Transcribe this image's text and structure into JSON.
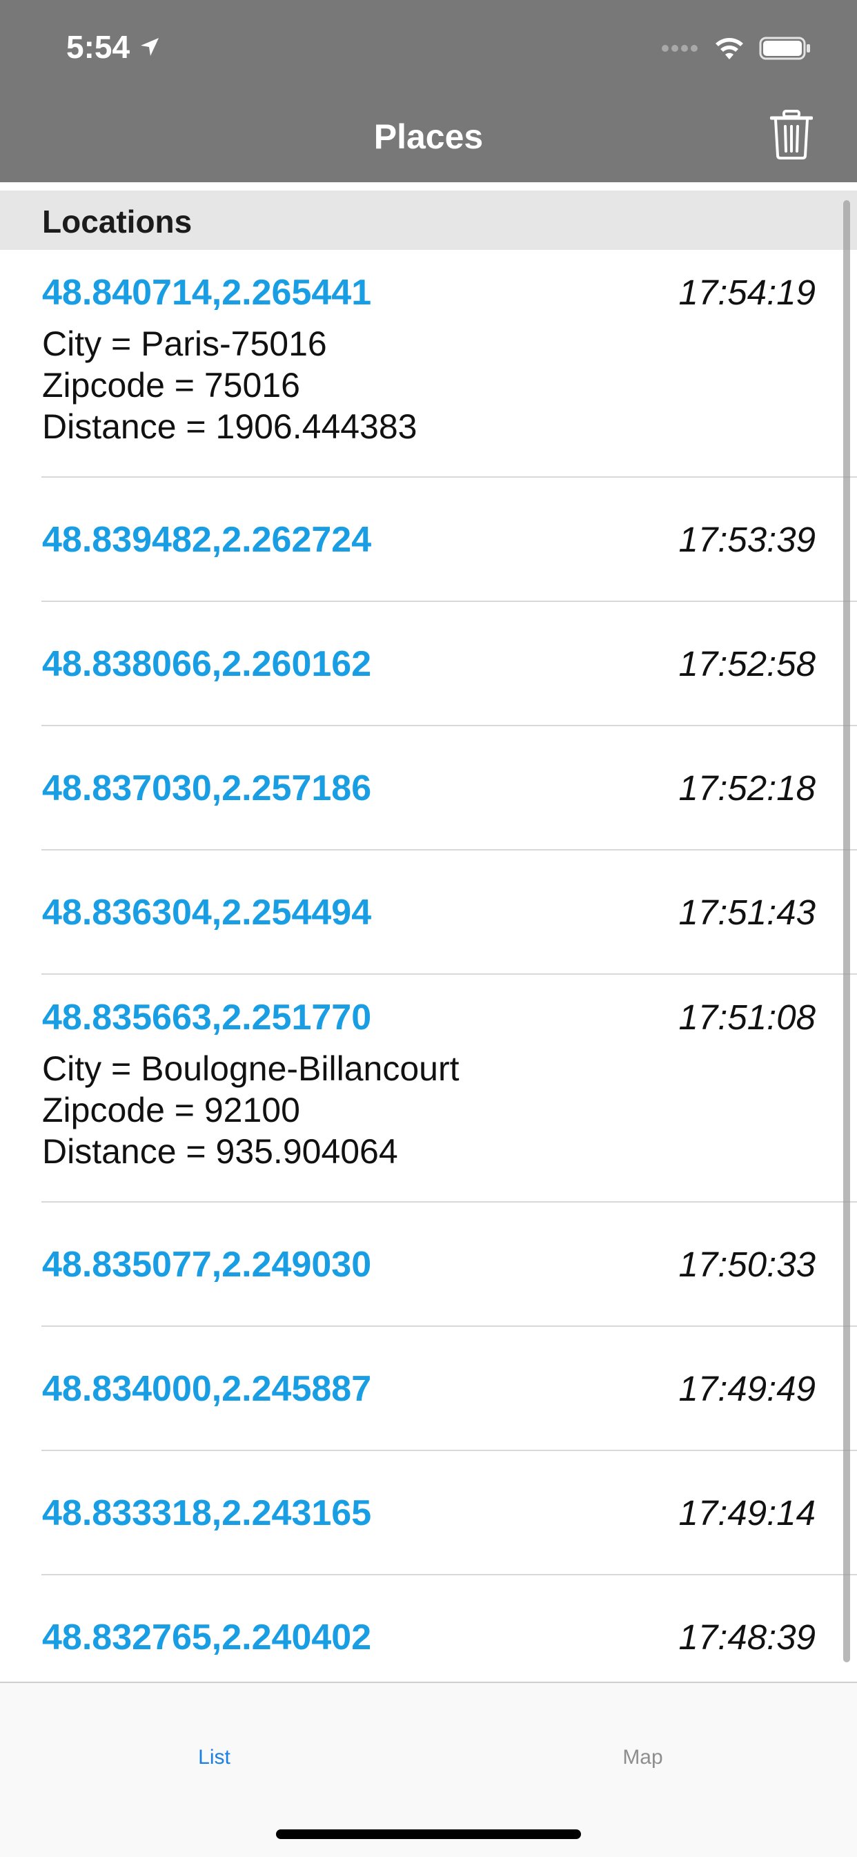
{
  "status_bar": {
    "time": "5:54",
    "icons": [
      "location-arrow-icon",
      "signal-dots-icon",
      "wifi-icon",
      "battery-icon"
    ]
  },
  "nav": {
    "title": "Places",
    "action_icon": "trash-icon"
  },
  "section": {
    "title": "Locations"
  },
  "locations": [
    {
      "coords": "48.840714,2.265441",
      "time": "17:54:19",
      "city": "City = Paris-75016",
      "zipcode": "Zipcode = 75016",
      "distance": "Distance = 1906.444383"
    },
    {
      "coords": "48.839482,2.262724",
      "time": "17:53:39"
    },
    {
      "coords": "48.838066,2.260162",
      "time": "17:52:58"
    },
    {
      "coords": "48.837030,2.257186",
      "time": "17:52:18"
    },
    {
      "coords": "48.836304,2.254494",
      "time": "17:51:43"
    },
    {
      "coords": "48.835663,2.251770",
      "time": "17:51:08",
      "city": "City = Boulogne-Billancourt",
      "zipcode": "Zipcode = 92100",
      "distance": "Distance = 935.904064"
    },
    {
      "coords": "48.835077,2.249030",
      "time": "17:50:33"
    },
    {
      "coords": "48.834000,2.245887",
      "time": "17:49:49"
    },
    {
      "coords": "48.833318,2.243165",
      "time": "17:49:14"
    },
    {
      "coords": "48.832765,2.240402",
      "time": "17:48:39"
    }
  ],
  "tabs": [
    {
      "label": "List",
      "selected": true
    },
    {
      "label": "Map",
      "selected": false
    }
  ],
  "colors": {
    "nav_background": "#787878",
    "link_blue": "#1a9ee3",
    "tab_selected": "#1d7fe0",
    "tab_unselected": "#8e8e8e",
    "section_background": "#e6e6e6"
  }
}
